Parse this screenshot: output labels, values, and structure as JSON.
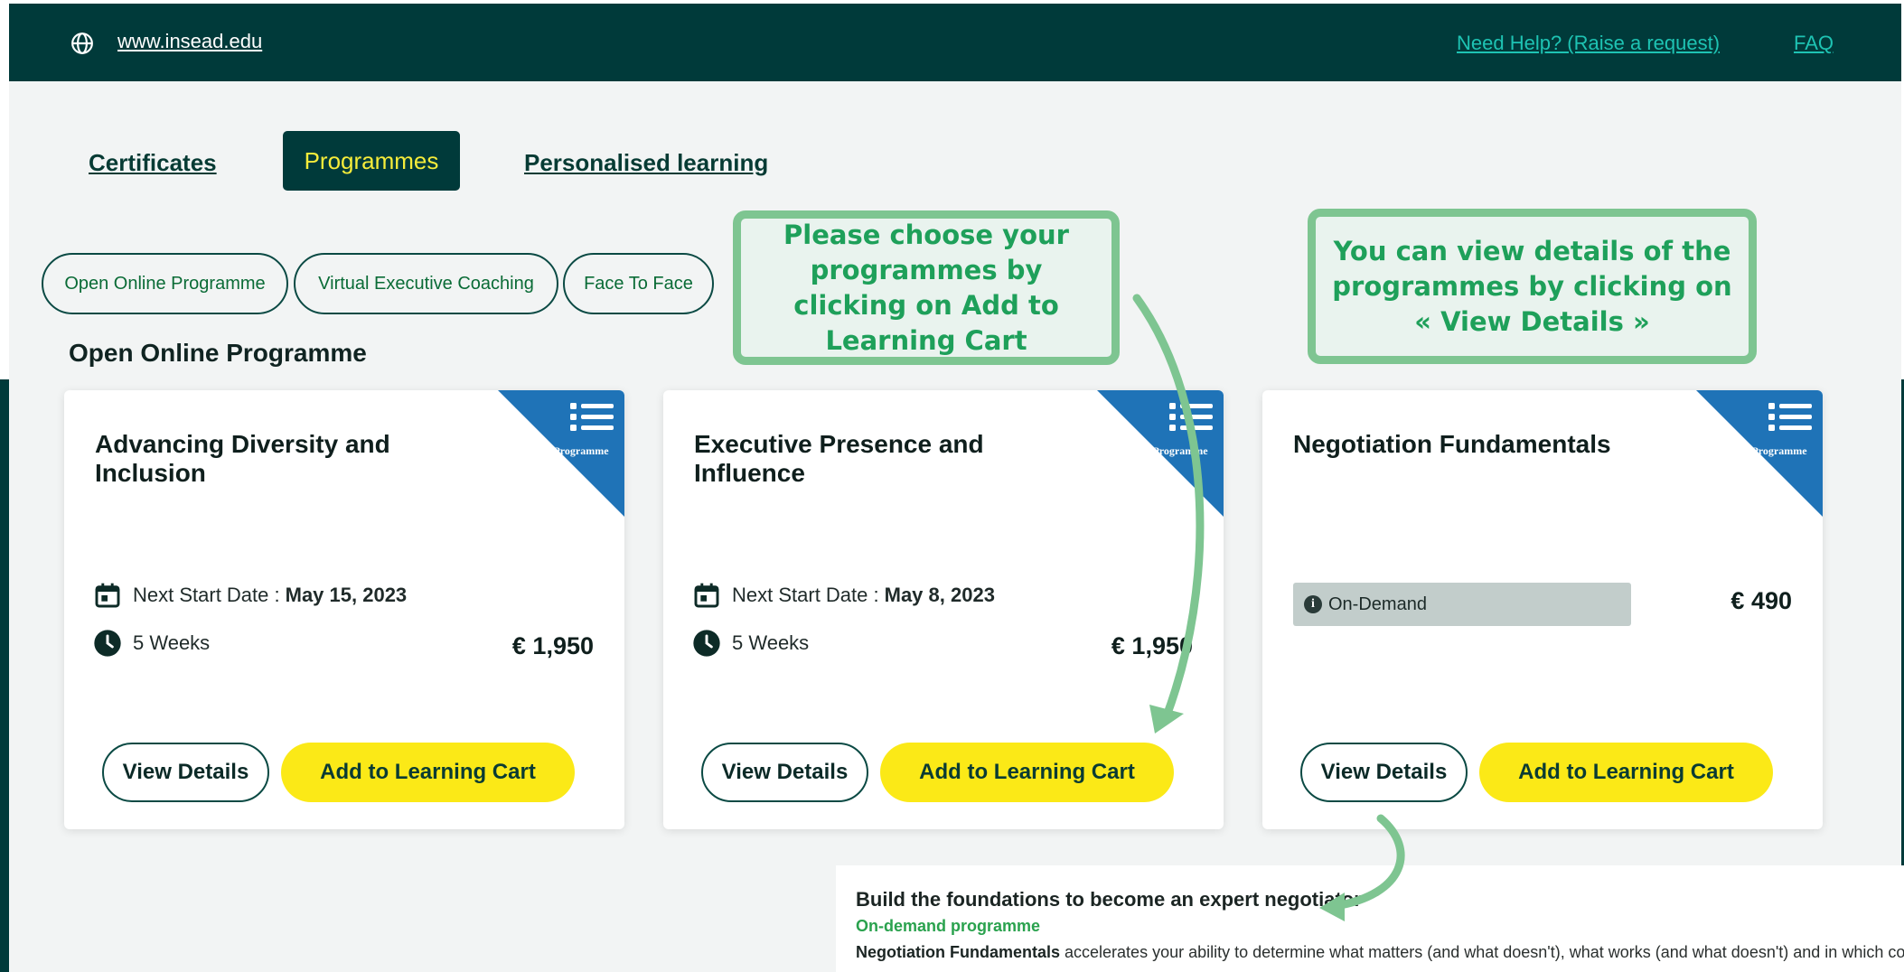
{
  "header": {
    "site_link": "www.insead.edu",
    "help_link": "Need Help? (Raise a request)",
    "faq_link": "FAQ"
  },
  "tabs": [
    {
      "label": "Certificates",
      "active": false
    },
    {
      "label": "Programmes",
      "active": true
    },
    {
      "label": "Personalised learning",
      "active": false
    }
  ],
  "filters": [
    "Open Online Programme",
    "Virtual Executive Coaching",
    "Face To Face"
  ],
  "section_title": "Open Online Programme",
  "corner_label": "Programme",
  "cards": [
    {
      "title": "Advancing Diversity and Inclusion",
      "date_label": "Next Start Date :",
      "date": "May 15, 2023",
      "duration": "5 Weeks",
      "price": "€ 1,950",
      "view_label": "View Details",
      "cart_label": "Add to Learning Cart"
    },
    {
      "title": "Executive Presence and Influence",
      "date_label": "Next Start Date :",
      "date": "May 8, 2023",
      "duration": "5 Weeks",
      "price": "€ 1,950",
      "view_label": "View Details",
      "cart_label": "Add to Learning Cart"
    },
    {
      "title": "Negotiation Fundamentals",
      "badge": "On-Demand",
      "price": "€ 490",
      "view_label": "View Details",
      "cart_label": "Add to Learning Cart"
    }
  ],
  "callouts": {
    "left": "Please choose your programmes by clicking on Add to Learning Cart",
    "right": "You can view details of the programmes by clicking on « View Details »"
  },
  "detail": {
    "title": "Build the foundations to become an expert negotiator",
    "subtitle": "On-demand programme",
    "body_bold": "Negotiation Fundamentals",
    "body_text": " accelerates your ability to determine what matters (and what doesn't), what works (and what doesn't) and in which contexts; and to i"
  },
  "colors": {
    "header_bg": "#003a3a",
    "accent_yellow": "#fbe917",
    "link_teal": "#1ec3b3",
    "callout_green": "#1ea05a",
    "corner_blue": "#1f73b7"
  }
}
